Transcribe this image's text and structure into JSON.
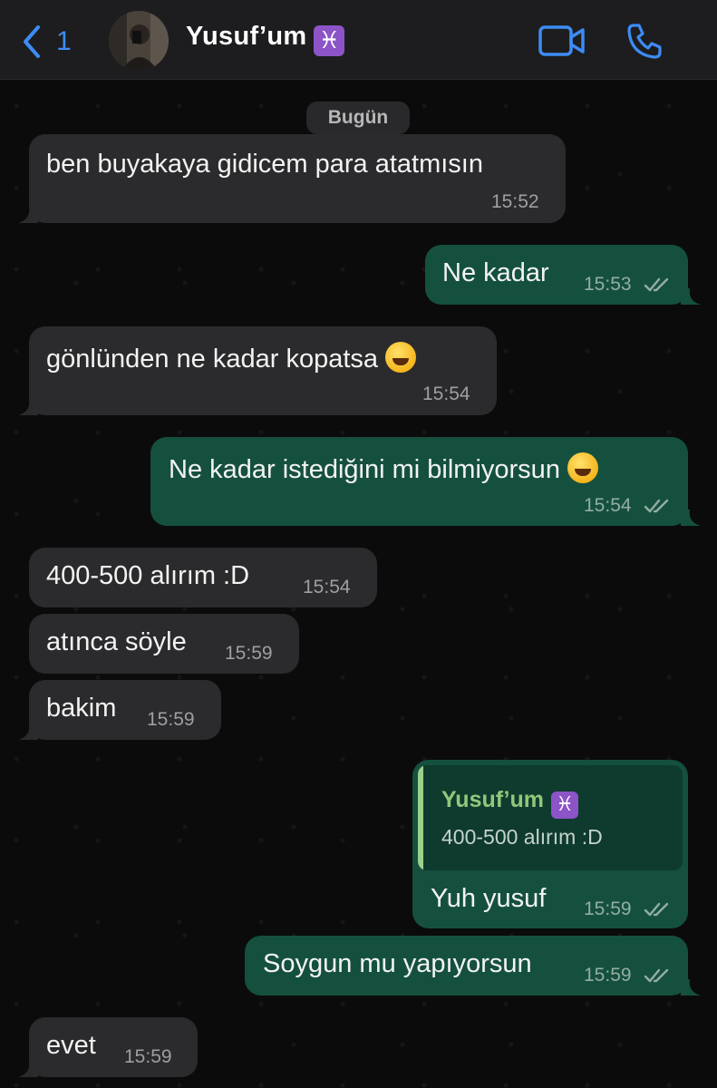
{
  "header": {
    "back_count": "1",
    "contact_name": "Yusuf’um",
    "contact_emoji": "♓"
  },
  "day_label": "Bugün",
  "messages": [
    {
      "direction": "in",
      "text": "ben buyakaya gidicem para atatmısın",
      "time": "15:52"
    },
    {
      "direction": "out",
      "text": "Ne kadar",
      "time": "15:53"
    },
    {
      "direction": "in",
      "text": "gönlünden ne kadar kopatsa",
      "emoji": "grinning-sweat-emoji",
      "time": "15:54"
    },
    {
      "direction": "out",
      "text": "Ne kadar istediğini mi bilmiyorsun",
      "emoji": "grinning-emoji",
      "time": "15:54"
    },
    {
      "direction": "in",
      "text": "400-500 alırım :D",
      "time": "15:54"
    },
    {
      "direction": "in",
      "text": "atınca söyle",
      "time": "15:59"
    },
    {
      "direction": "in",
      "text": "bakim",
      "time": "15:59"
    },
    {
      "direction": "out",
      "text": "Yuh yusuf",
      "time": "15:59",
      "reply_to": {
        "author": "Yusuf’um",
        "author_emoji": "♓",
        "text": "400-500 alırım :D"
      }
    },
    {
      "direction": "out",
      "text": "Soygun mu yapıyorsun",
      "time": "15:59"
    },
    {
      "direction": "in",
      "text": "evet",
      "time": "15:59"
    }
  ],
  "colors": {
    "accent": "#3d8cf5",
    "incoming_bubble": "#2b2b2d",
    "outgoing_bubble": "#15503f",
    "reply_author": "#8fc87b"
  }
}
